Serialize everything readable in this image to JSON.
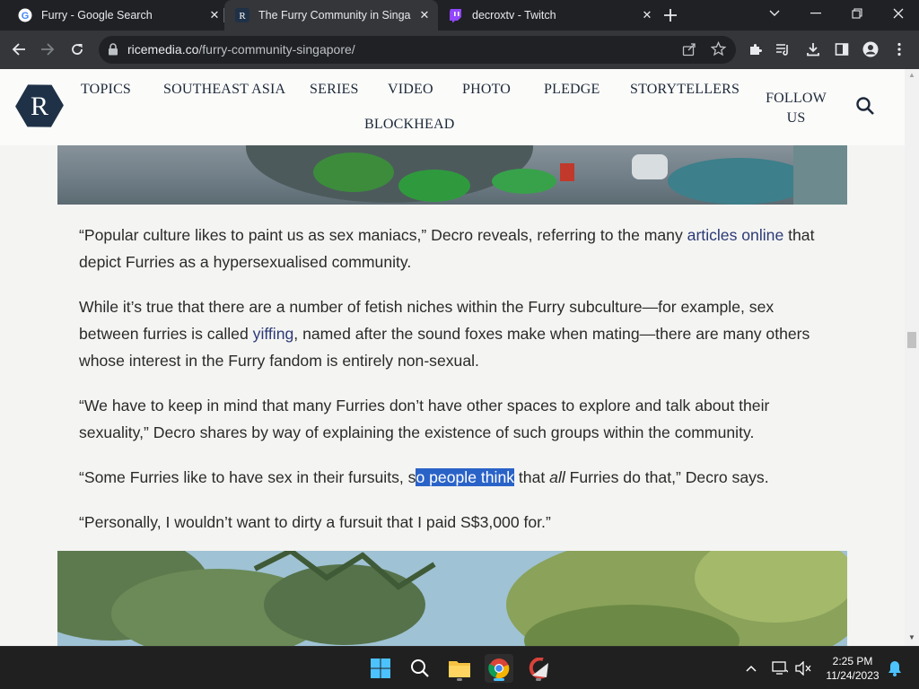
{
  "browser": {
    "tabs": [
      {
        "title": "Furry - Google Search",
        "favicon": "google-icon"
      },
      {
        "title": "The Furry Community in Singapo",
        "favicon": "ricemedia-icon"
      },
      {
        "title": "decroxtv - Twitch",
        "favicon": "twitch-icon"
      }
    ],
    "active_tab": 1,
    "url_host": "ricemedia.co",
    "url_path": "/furry-community-singapore/"
  },
  "site": {
    "logo_letter": "R",
    "nav": {
      "topics": "TOPICS",
      "southeast_asia": "SOUTHEAST ASIA",
      "series": "SERIES",
      "video": "VIDEO",
      "photo": "PHOTO",
      "pledge": "PLEDGE",
      "storytellers": "STORYTELLERS",
      "follow_line1": "FOLLOW",
      "follow_line2": "US",
      "blockhead": "BLOCKHEAD"
    }
  },
  "article": {
    "p1_a": "“Popular culture likes to paint us as sex maniacs,” Decro reveals, referring to the many ",
    "p1_link": "articles online",
    "p1_b": " that depict Furries as a hypersexualised community.",
    "p2_a": "While it’s true that there are a number of fetish niches within the Furry subculture—for example, sex between furries is called ",
    "p2_link": "yiffing",
    "p2_b": ", named after the sound foxes make when mating—there are many others whose interest in the Furry fandom is entirely non-sexual.",
    "p3": "“We have to keep in mind that many Furries don’t have other spaces to explore and talk about their sexuality,” Decro shares by way of explaining the existence of such groups within the community.",
    "p4_a": "“Some Furries like to have sex in their fursuits, s",
    "p4_highlight": "o people think",
    "p4_b": " that ",
    "p4_em": "all",
    "p4_c": " Furries do that,” Decro says.",
    "p5": "“Personally, I wouldn’t want to dirty a fursuit that I paid S$3,000 for.”"
  },
  "taskbar": {
    "time": "2:25 PM",
    "date": "11/24/2023"
  },
  "colors": {
    "link": "#2b3a77",
    "selection": "#2a63c8",
    "logo_bg": "#1f3147",
    "browser_dark": "#202124"
  }
}
